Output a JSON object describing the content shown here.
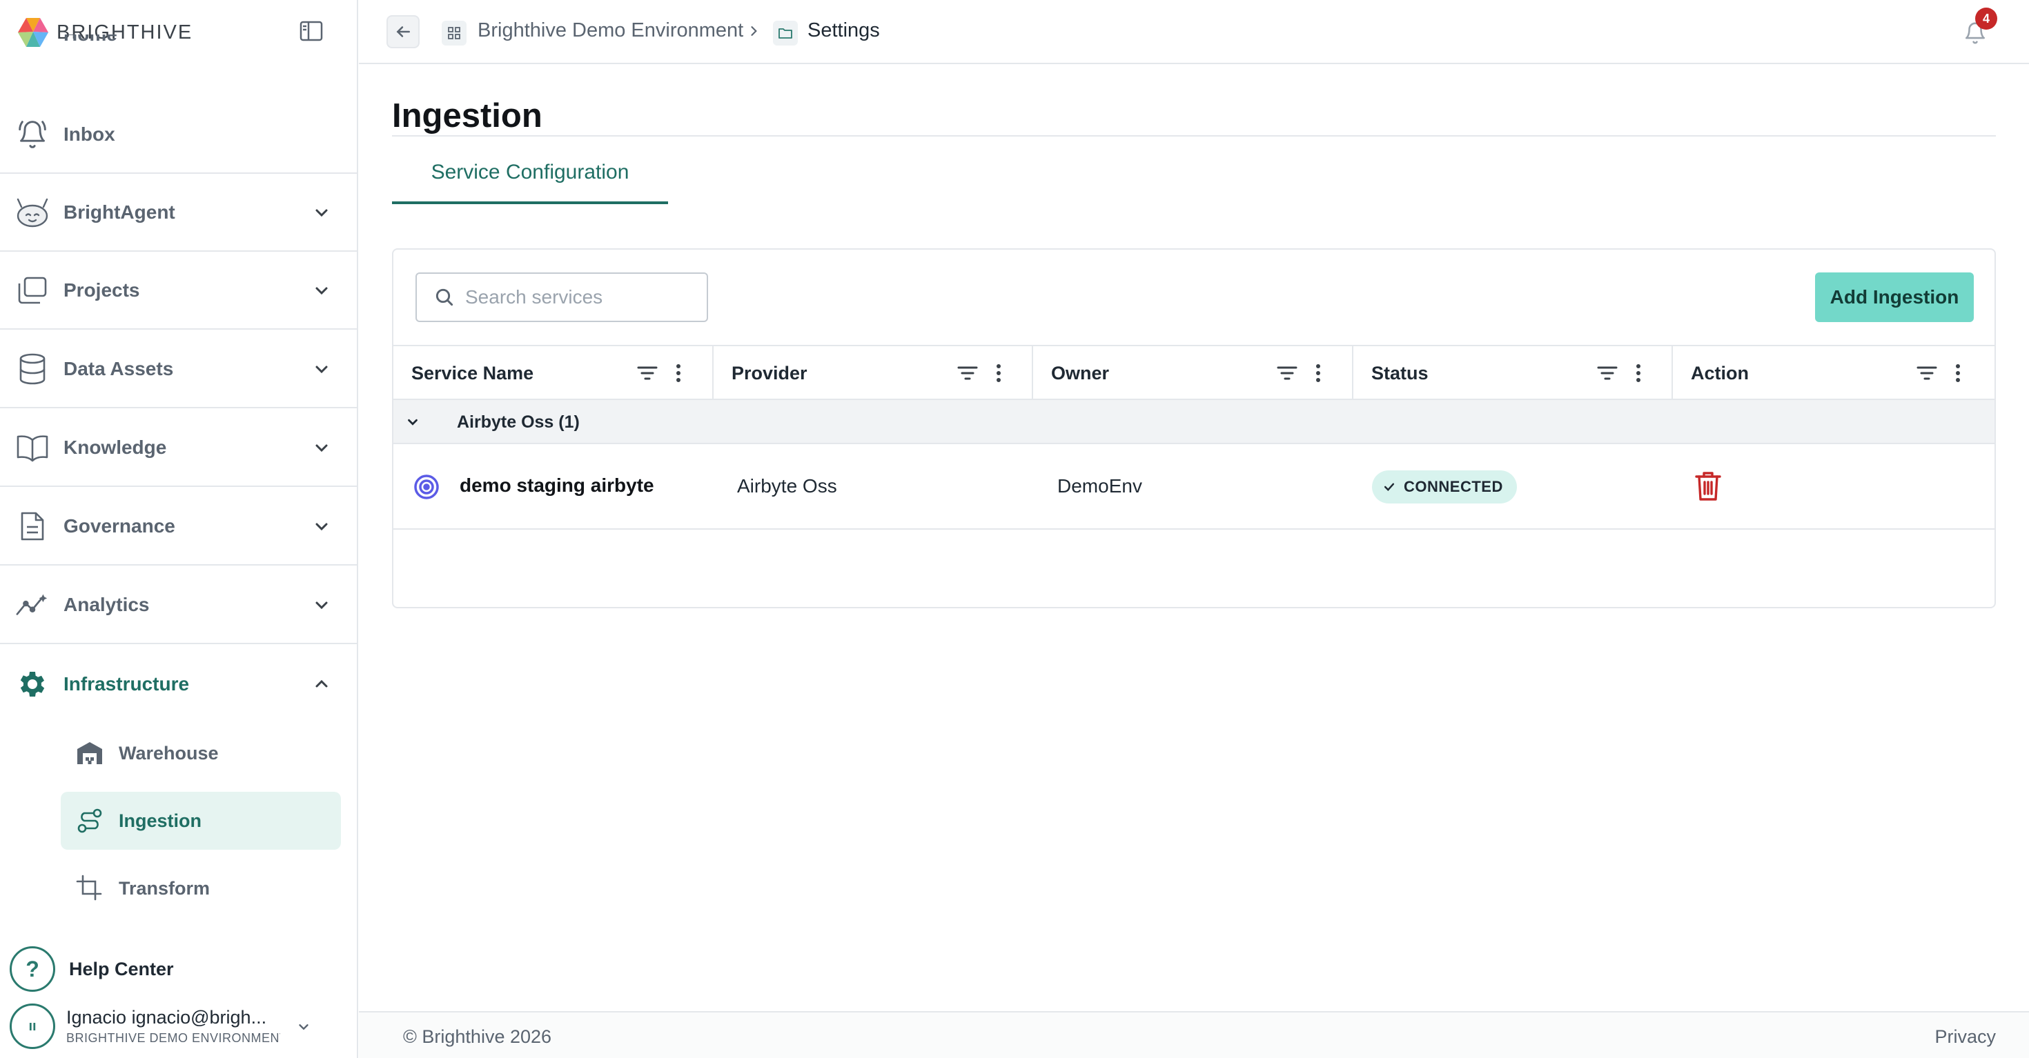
{
  "brand": {
    "name": "BRIGHTHIVE"
  },
  "sidebar": {
    "items": [
      {
        "label": "Home",
        "icon": "home-icon"
      },
      {
        "label": "Inbox",
        "icon": "bell-ring-icon"
      },
      {
        "label": "BrightAgent",
        "icon": "robot-icon"
      },
      {
        "label": "Projects",
        "icon": "folders-icon"
      },
      {
        "label": "Data Assets",
        "icon": "database-icon"
      },
      {
        "label": "Knowledge",
        "icon": "book-open-icon"
      },
      {
        "label": "Governance",
        "icon": "document-icon"
      },
      {
        "label": "Analytics",
        "icon": "trend-chart-icon"
      },
      {
        "label": "Infrastructure",
        "icon": "gear-icon"
      }
    ],
    "sub_items": [
      {
        "label": "Warehouse",
        "icon": "warehouse-icon"
      },
      {
        "label": "Ingestion",
        "icon": "route-icon"
      },
      {
        "label": "Transform",
        "icon": "crop-icon"
      }
    ],
    "help": {
      "label": "Help Center",
      "glyph": "?"
    },
    "user": {
      "avatar_glyph": "ıı",
      "name": "Ignacio ignacio@brigh...",
      "env": "BRIGHTHIVE DEMO ENVIRONMENT"
    }
  },
  "topbar": {
    "breadcrumb": [
      "Brighthive Demo Environment",
      "Settings"
    ],
    "notifications": "4"
  },
  "main": {
    "title": "Ingestion",
    "tabs": [
      {
        "label": "Service Configuration"
      }
    ],
    "search": {
      "placeholder": "Search services",
      "value": ""
    },
    "add_button": "Add Ingestion",
    "table": {
      "columns": [
        "Service Name",
        "Provider",
        "Owner",
        "Status",
        "Action"
      ],
      "group": {
        "label": "Airbyte Oss (1)"
      },
      "rows": [
        {
          "service": "demo staging airbyte",
          "provider": "Airbyte Oss",
          "owner": "DemoEnv",
          "status": "CONNECTED"
        }
      ]
    }
  },
  "colors": {
    "accent": "#1f6e63",
    "button": "#73d8c9",
    "status_bg": "#d8f3ee",
    "danger": "#c62828"
  },
  "footer": {
    "copyright": "© Brighthive 2026",
    "privacy": "Privacy"
  }
}
